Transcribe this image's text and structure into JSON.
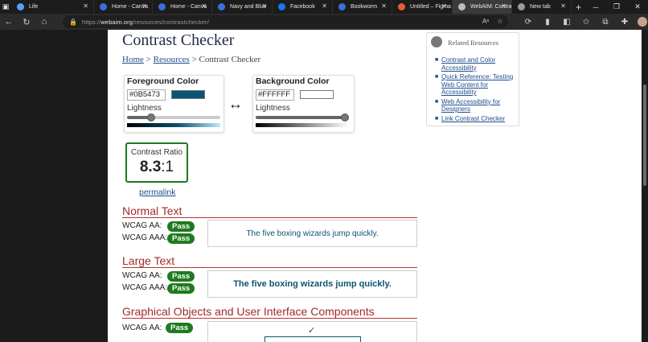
{
  "tabs": [
    {
      "label": "Life",
      "color": "#5aa0ff",
      "width": 103,
      "active": false
    },
    {
      "label": "Home - Canva",
      "color": "#3b6fd9",
      "width": 73,
      "active": false
    },
    {
      "label": "Home - Canva",
      "color": "#3b6fd9",
      "width": 74,
      "active": false
    },
    {
      "label": "Navy and Blue",
      "color": "#3b6fd9",
      "width": 75,
      "active": false
    },
    {
      "label": "Facebook",
      "color": "#1877f2",
      "width": 75,
      "active": false
    },
    {
      "label": "Bookworm",
      "color": "#3b6fd9",
      "width": 74,
      "active": false
    },
    {
      "label": "Untitled – Figma",
      "color": "#e85a3b",
      "width": 75,
      "active": false
    },
    {
      "label": "WebAIM: Contrast",
      "color": "#bdbdbd",
      "width": 74,
      "active": true
    },
    {
      "label": "New tab",
      "color": "#9a9a9a",
      "width": 74,
      "active": false
    }
  ],
  "browser": {
    "url_prefix": "https://",
    "url_host": "webaim.org",
    "url_path": "/resources/contrastchecker/",
    "newtab_glyph": "+"
  },
  "page": {
    "title": "Contrast Checker",
    "breadcrumb": {
      "home": "Home",
      "sep1": ">",
      "resources": "Resources",
      "sep2": ">",
      "current": "Contrast Checker"
    },
    "foreground": {
      "label": "Foreground Color",
      "hex": "#0B5473",
      "swatch": "#0B5473",
      "lightness_label": "Lightness",
      "lightness": 0.24
    },
    "background": {
      "label": "Background Color",
      "hex": "#FFFFFF",
      "swatch": "#FFFFFF",
      "lightness_label": "Lightness",
      "lightness": 1.0
    },
    "swap_glyph": "↔",
    "contrast": {
      "label": "Contrast Ratio",
      "value": "8.3",
      "suffix": ":1"
    },
    "permalink": "permalink",
    "normal_text": {
      "heading": "Normal Text",
      "aa_label": "WCAG AA:",
      "aa_result": "Pass",
      "aaa_label": "WCAG AAA:",
      "aaa_result": "Pass",
      "sample": "The five boxing wizards jump quickly."
    },
    "large_text": {
      "heading": "Large Text",
      "aa_label": "WCAG AA:",
      "aa_result": "Pass",
      "aaa_label": "WCAG AAA:",
      "aaa_result": "Pass",
      "sample": "The five boxing wizards jump quickly."
    },
    "graphics": {
      "heading": "Graphical Objects and User Interface Components",
      "aa_label": "WCAG AA:",
      "aa_result": "Pass",
      "check_glyph": "✓"
    }
  },
  "related": {
    "title": "Related Resources",
    "items": [
      "Contrast and Color Accessibility",
      "Quick Reference: Testing Web Content for Accessibility",
      "Web Accessibility for Designers",
      "Link Contrast Checker"
    ]
  },
  "colors": {
    "pass_green": "#1f7a1f",
    "heading_red": "#a12a2a",
    "link_blue": "#1e4c8c"
  }
}
